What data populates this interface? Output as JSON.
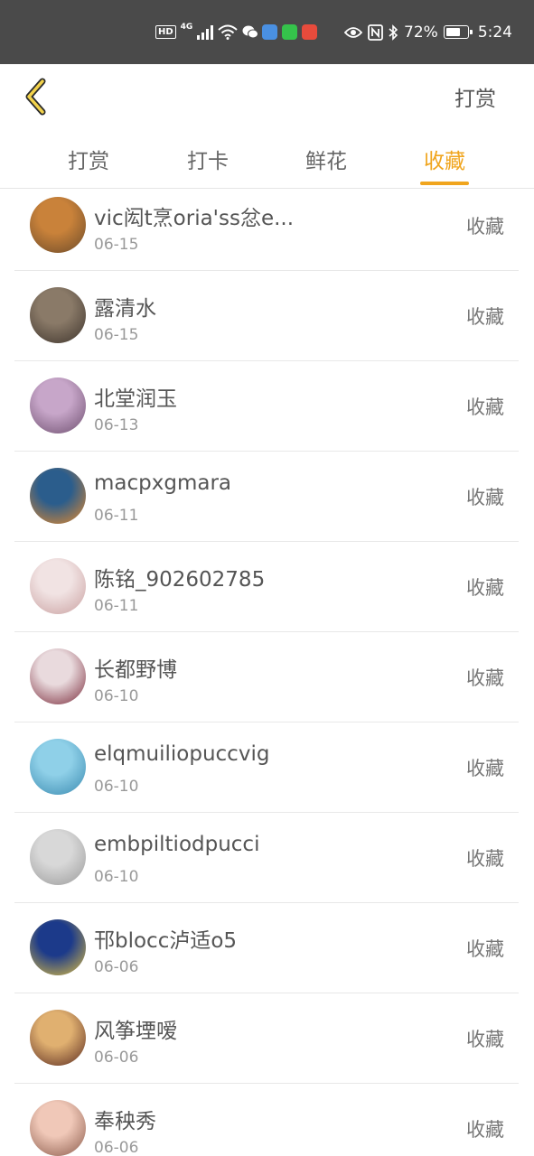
{
  "status_bar": {
    "battery_percent": "72%",
    "battery_level": 0.72,
    "time": "5:24",
    "hd_label": "HD",
    "network_label": "4G",
    "app_icons": [
      {
        "name": "wechat-icon",
        "color": "#ffffff"
      },
      {
        "name": "blue-app-icon",
        "color": "#4a90e2"
      },
      {
        "name": "line-app-icon",
        "color": "#35c34b"
      },
      {
        "name": "red-app-icon",
        "color": "#e84b3c"
      }
    ]
  },
  "header": {
    "back_icon": "chevron-left-icon",
    "action_label": "打赏",
    "accent_color": "#f0a51e"
  },
  "tabs": [
    {
      "label": "打赏",
      "active": false
    },
    {
      "label": "打卡",
      "active": false
    },
    {
      "label": "鲜花",
      "active": false
    },
    {
      "label": "收藏",
      "active": true
    }
  ],
  "list": [
    {
      "name": "vic闳t烹oria'ss忿e...",
      "date": "06-15",
      "action": "收藏",
      "avatar_colors": [
        "#c9823a",
        "#6b4a2a"
      ]
    },
    {
      "name": "露清水",
      "date": "06-15",
      "action": "收藏",
      "avatar_colors": [
        "#8a7a68",
        "#3e342c"
      ]
    },
    {
      "name": "北堂润玉",
      "date": "06-13",
      "action": "收藏",
      "avatar_colors": [
        "#c7a6c9",
        "#6e4f6f"
      ]
    },
    {
      "name": "macpxgmara",
      "date": "06-11",
      "action": "收藏",
      "avatar_colors": [
        "#2b5d8c",
        "#e88a2a"
      ]
    },
    {
      "name": "陈铭_902602785",
      "date": "06-11",
      "action": "收藏",
      "avatar_colors": [
        "#f1e3e3",
        "#c9a0a0"
      ]
    },
    {
      "name": "长都野博",
      "date": "06-10",
      "action": "收藏",
      "avatar_colors": [
        "#e9dadd",
        "#7a2a3a"
      ]
    },
    {
      "name": "elqmuiliopuccvig",
      "date": "06-10",
      "action": "收藏",
      "avatar_colors": [
        "#8fd0e8",
        "#3a8ab0"
      ]
    },
    {
      "name": "embpiltiodpucci",
      "date": "06-10",
      "action": "收藏",
      "avatar_colors": [
        "#d8d8d8",
        "#9a9a9a"
      ]
    },
    {
      "name": "邗blocc泸适o5",
      "date": "06-06",
      "action": "收藏",
      "avatar_colors": [
        "#1c3a8a",
        "#e0c040"
      ]
    },
    {
      "name": "风筝堙嗳",
      "date": "06-06",
      "action": "收藏",
      "avatar_colors": [
        "#e0b070",
        "#5a2a20"
      ]
    },
    {
      "name": "奉秧秀",
      "date": "06-06",
      "action": "收藏",
      "avatar_colors": [
        "#f0c8b8",
        "#8a5a4a"
      ]
    }
  ]
}
